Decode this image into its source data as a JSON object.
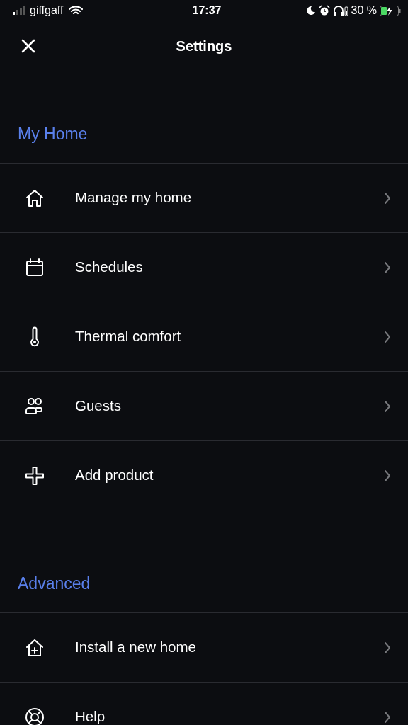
{
  "status_bar": {
    "carrier": "giffgaff",
    "time": "17:37",
    "battery_percent": "30 %"
  },
  "header": {
    "title": "Settings"
  },
  "sections": [
    {
      "title": "My Home",
      "items": [
        {
          "label": "Manage my home",
          "kind": "home"
        },
        {
          "label": "Schedules",
          "kind": "calendar"
        },
        {
          "label": "Thermal comfort",
          "kind": "thermometer"
        },
        {
          "label": "Guests",
          "kind": "guests"
        },
        {
          "label": "Add product",
          "kind": "plus"
        }
      ]
    },
    {
      "title": "Advanced",
      "items": [
        {
          "label": "Install a new home",
          "kind": "home-plus"
        },
        {
          "label": "Help",
          "kind": "lifebuoy"
        }
      ]
    }
  ]
}
